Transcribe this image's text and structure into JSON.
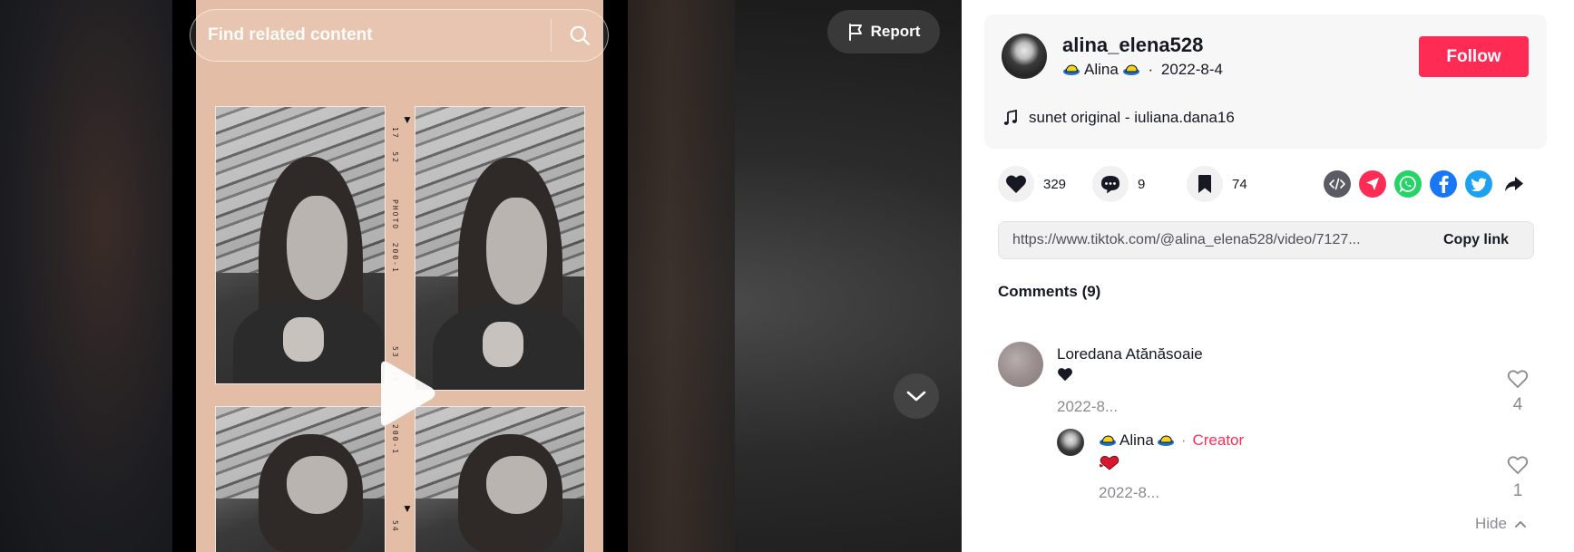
{
  "video": {
    "search_placeholder": "Find related content",
    "report_label": "Report",
    "film_labels": {
      "top_right_numbers": "17  52",
      "photo_label": "PHOTO  200-1",
      "mid_numbers": "53  18",
      "mid_label": "200-1",
      "bottom_numbers": "54"
    }
  },
  "author": {
    "username": "alina_elena528",
    "nickname": "Alina",
    "date": "2022-8-4",
    "follow_label": "Follow",
    "music": "sunet original - iuliana.dana16"
  },
  "actions": {
    "likes": "329",
    "comments": "9",
    "saves": "74"
  },
  "share_icons": [
    "embed-icon",
    "send-icon",
    "whatsapp-icon",
    "facebook-icon",
    "twitter-icon",
    "share-arrow-icon"
  ],
  "colors": {
    "accent": "#fe2c55",
    "whatsapp": "#25d366",
    "facebook": "#1877f2",
    "twitter": "#1da1f2"
  },
  "link": {
    "url": "https://www.tiktok.com/@alina_elena528/video/7127...",
    "copy_label": "Copy link"
  },
  "comments": {
    "title": "Comments (9)",
    "items": [
      {
        "author": "Loredana Atănăsoaie",
        "text": "❤",
        "date": "2022-8...",
        "likes": "4",
        "replies": [
          {
            "author": "Alina",
            "separator": "·",
            "tag": "Creator",
            "text": "❤",
            "date": "2022-8...",
            "likes": "1"
          }
        ]
      }
    ],
    "hide_label": "Hide"
  }
}
